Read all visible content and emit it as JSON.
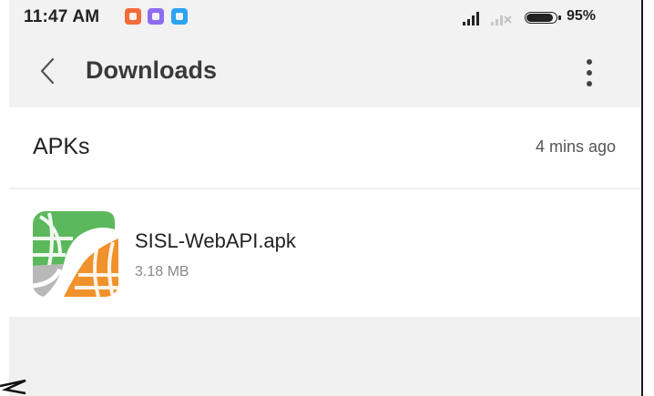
{
  "status_bar": {
    "time": "11:47 AM",
    "battery_percent": "95%",
    "battery_level": 0.95,
    "notification_icons": [
      "app-notification-orange-icon",
      "app-notification-purple-icon",
      "app-notification-blue-icon"
    ]
  },
  "header": {
    "title": "Downloads",
    "back_icon": "chevron-left-icon",
    "more_icon": "more-vertical-icon"
  },
  "section": {
    "title": "APKs",
    "time": "4 mins ago"
  },
  "files": [
    {
      "name": "SISL-WebAPI.apk",
      "size": "3.18 MB",
      "icon": "app-icon"
    }
  ],
  "colors": {
    "background": "#f2f2f2",
    "card": "#ffffff",
    "icon_green": "#5cb85c",
    "icon_orange": "#f0922b",
    "icon_gray": "#b8b8b8"
  }
}
